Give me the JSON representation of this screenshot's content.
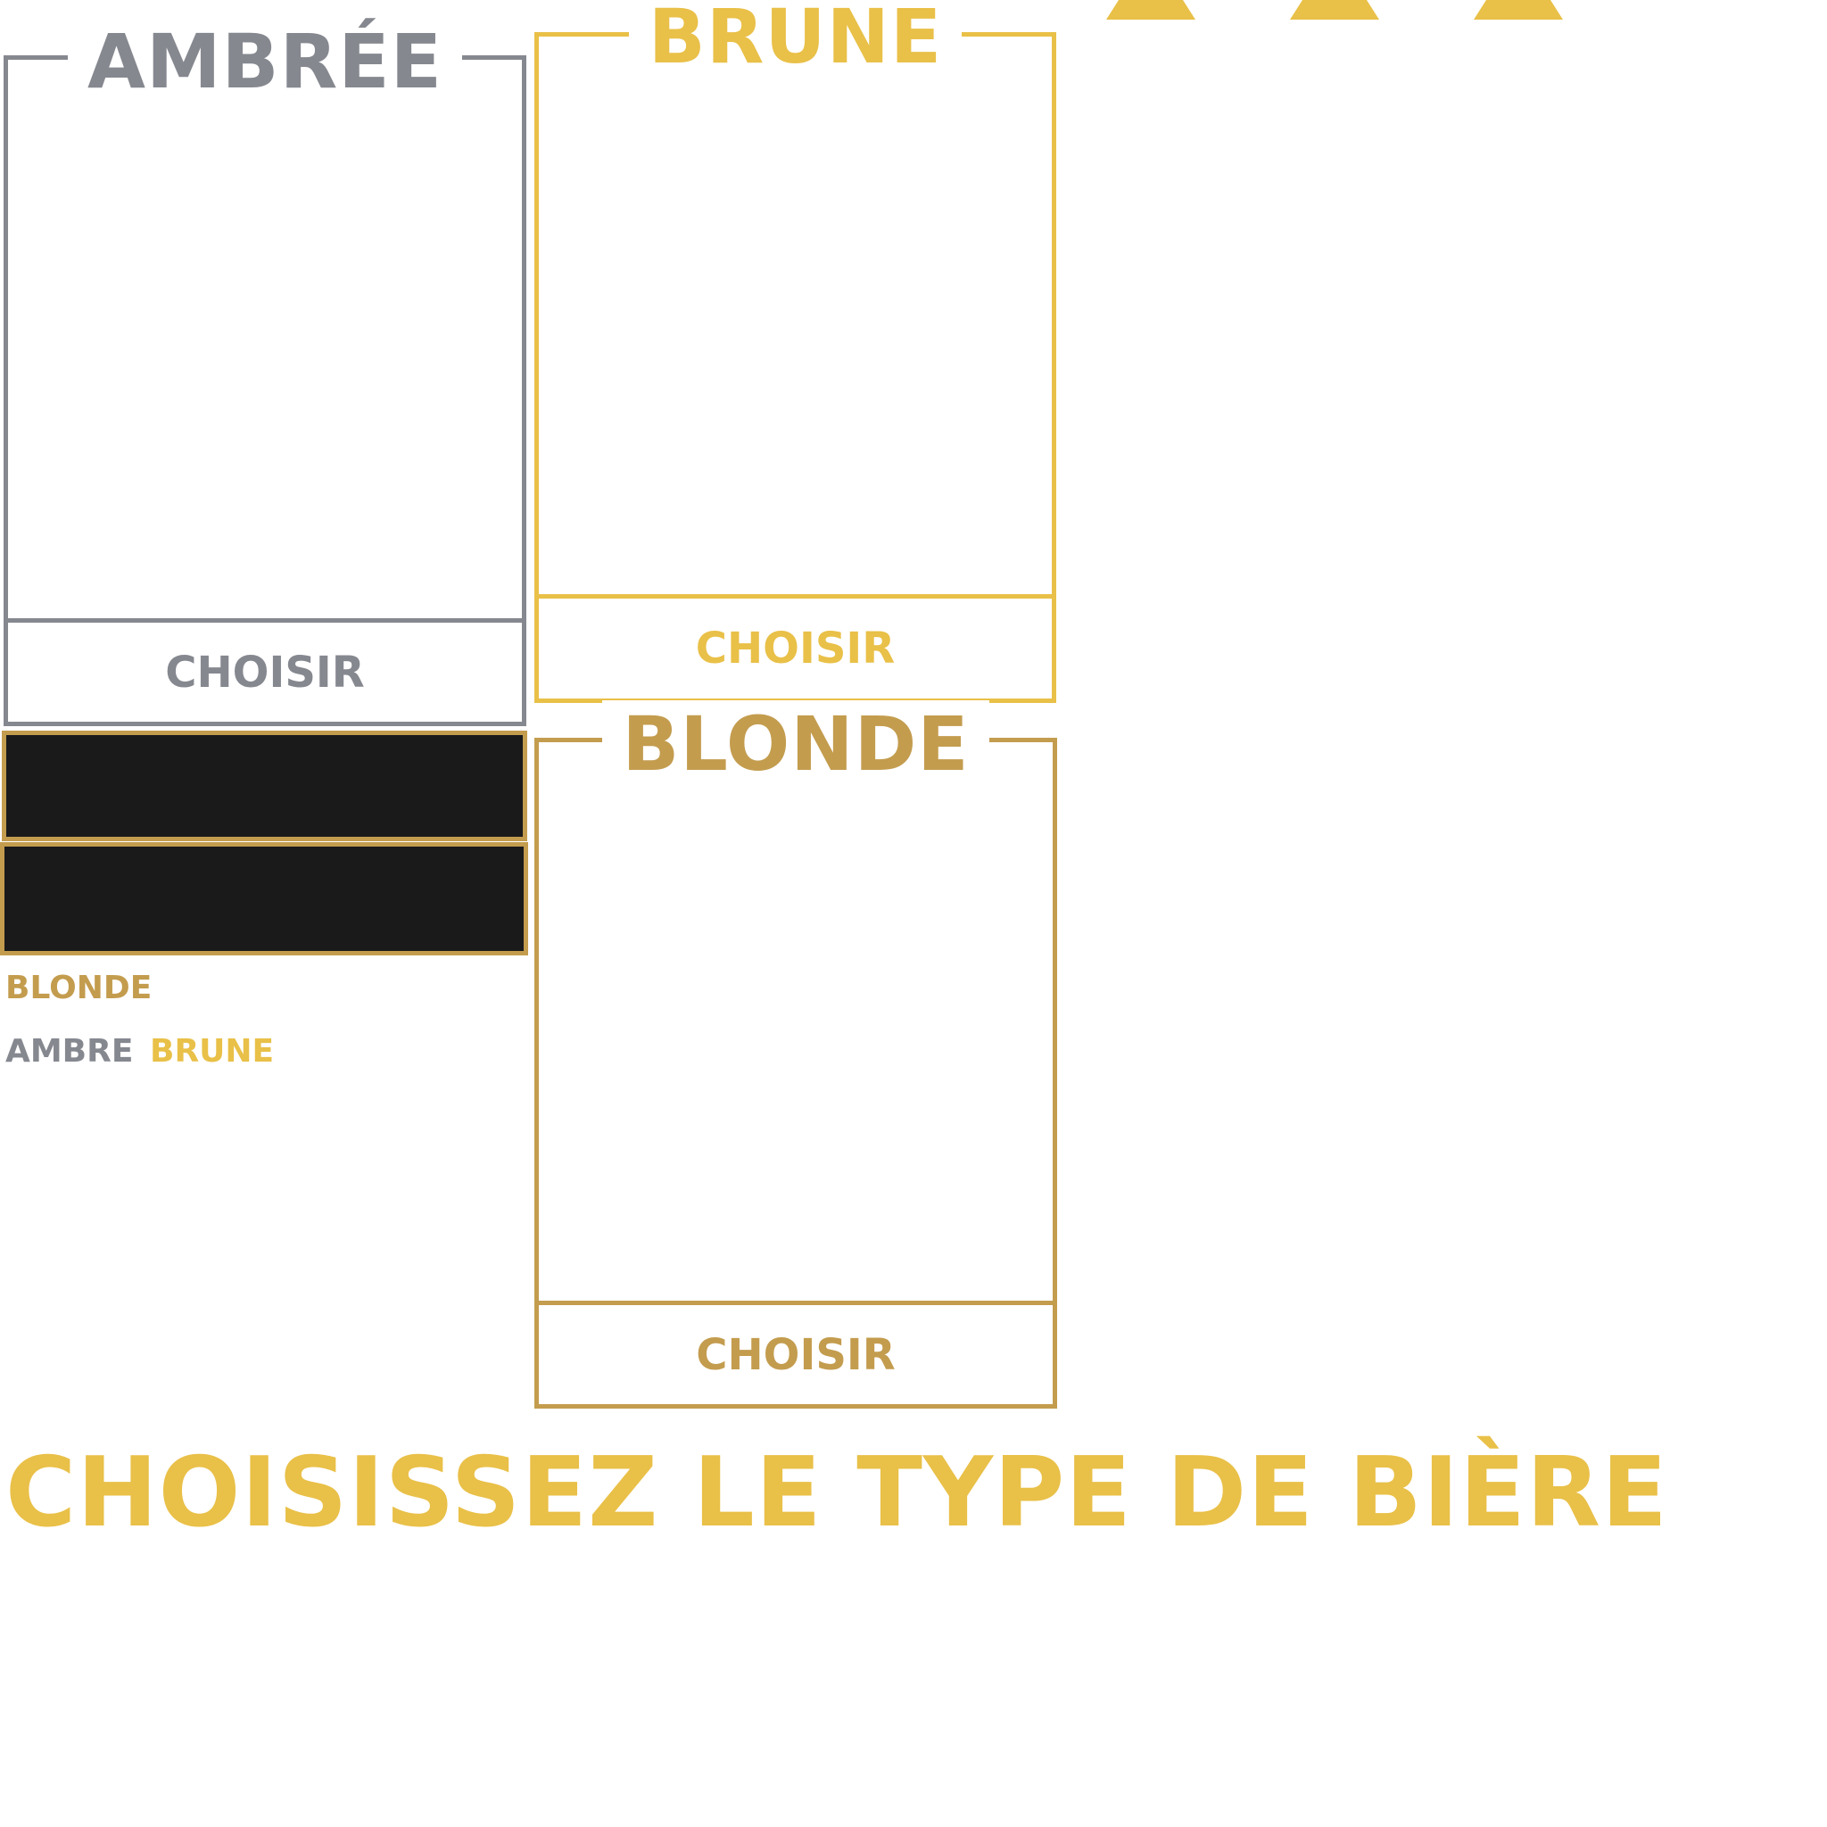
{
  "panels": {
    "ambree": {
      "title": "AMBRÉE",
      "button_label": "CHOISIR",
      "color": "#868890"
    },
    "brune": {
      "title": "BRUNE",
      "button_label": "CHOISIR",
      "color": "#e9c048"
    },
    "blonde": {
      "title": "BLONDE",
      "button_label": "CHOISIR",
      "color": "#c39c4e"
    }
  },
  "labels": {
    "blonde": "BLONDE",
    "ambre": "AMBRE",
    "brune": "BRUNE"
  },
  "heading": "CHOISISSEZ LE TYPE DE BIÈRE",
  "colors": {
    "grey": "#868890",
    "yellow": "#e9c048",
    "gold": "#c39c4e",
    "swatch": "#1a1a1a"
  }
}
